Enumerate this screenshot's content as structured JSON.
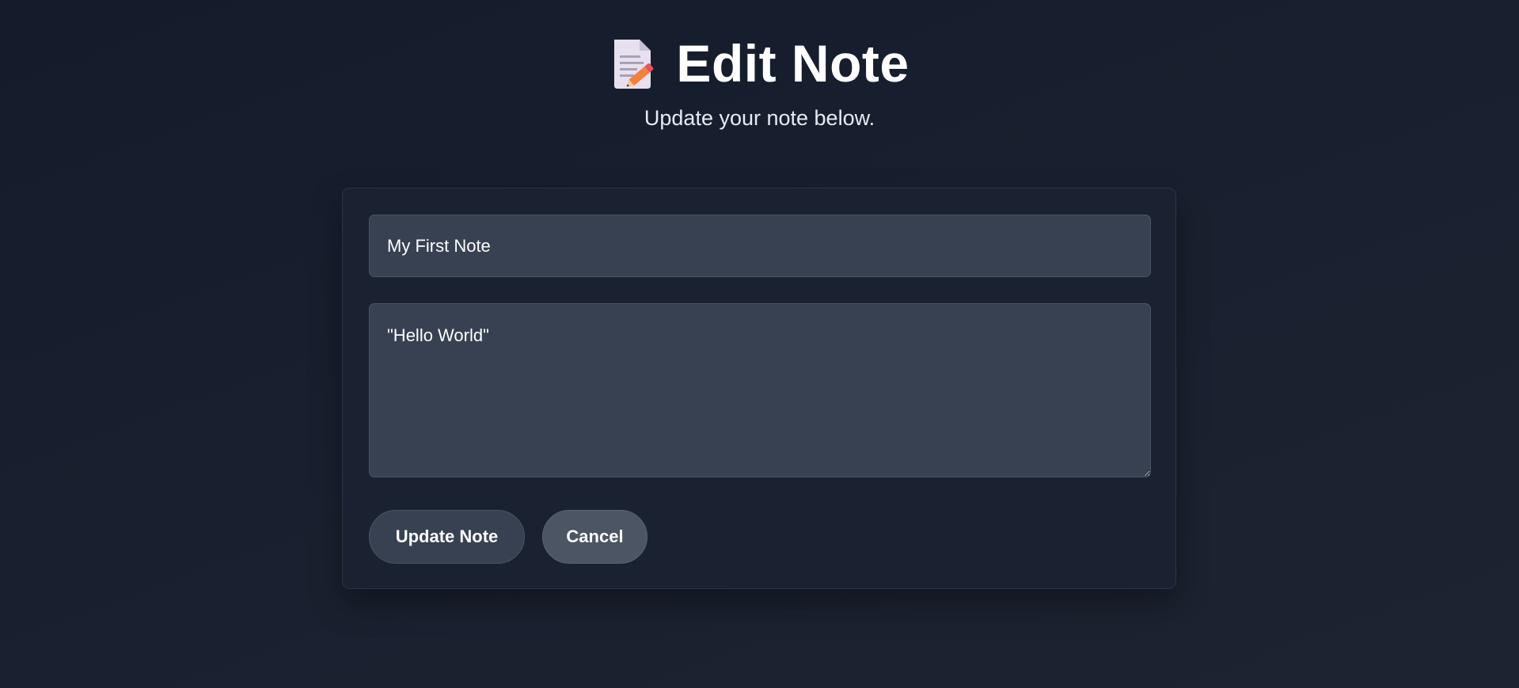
{
  "header": {
    "icon": "memo-icon",
    "title": "Edit Note",
    "subtitle": "Update your note below."
  },
  "form": {
    "title_value": "My First Note",
    "content_value": "\"Hello World\"",
    "update_label": "Update Note",
    "cancel_label": "Cancel"
  },
  "colors": {
    "background": "#161d2c",
    "card": "#1a2130",
    "input": "#374151",
    "update_button": "#374151",
    "cancel_button": "#4b5563"
  }
}
